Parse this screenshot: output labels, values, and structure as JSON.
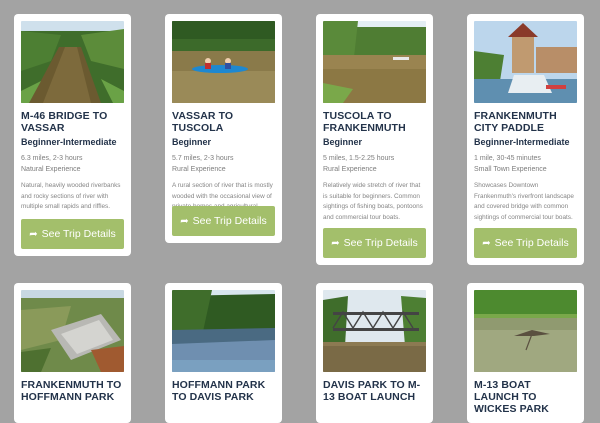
{
  "button_label": "See Trip Details",
  "colors": {
    "button": "#a3bf6b",
    "title": "#23334a",
    "background": "#a3a3a3"
  },
  "trips": [
    {
      "title": "M-46 BRIDGE TO VASSAR",
      "level": "Beginner-Intermediate",
      "distance": "6.3 miles, 2-3 hours",
      "experience": "Natural Experience",
      "description": "Natural, heavily wooded riverbanks and rocky sections of river with multiple small rapids and riffles."
    },
    {
      "title": "VASSAR TO TUSCOLA",
      "level": "Beginner",
      "distance": "5.7 miles, 2-3 hours",
      "experience": "Rural Experience",
      "description": "A rural section of river that is mostly wooded with the occasional view of private homes and agricultural fields."
    },
    {
      "title": "TUSCOLA TO FRANKENMUTH",
      "level": "Beginner",
      "distance": "5 miles, 1.5-2.25 hours",
      "experience": "Rural Experience",
      "description": "Relatively wide stretch of river that is suitable for beginners. Common sightings of fishing boats, pontoons and commercial tour boats."
    },
    {
      "title": "FRANKENMUTH CITY PADDLE",
      "level": "Beginner-Intermediate",
      "distance": "1 mile, 30-45 minutes",
      "experience": "Small Town Experience",
      "description": "Showcases Downtown Frankenmuth's riverfront landscape and covered bridge with common sightings of commercial tour boats."
    },
    {
      "title": "FRANKENMUTH TO HOFFMANN PARK"
    },
    {
      "title": "HOFFMANN PARK TO DAVIS PARK"
    },
    {
      "title": "DAVIS PARK TO M-13 BOAT LAUNCH"
    },
    {
      "title": "M-13 BOAT LAUNCH TO WICKES PARK"
    }
  ]
}
